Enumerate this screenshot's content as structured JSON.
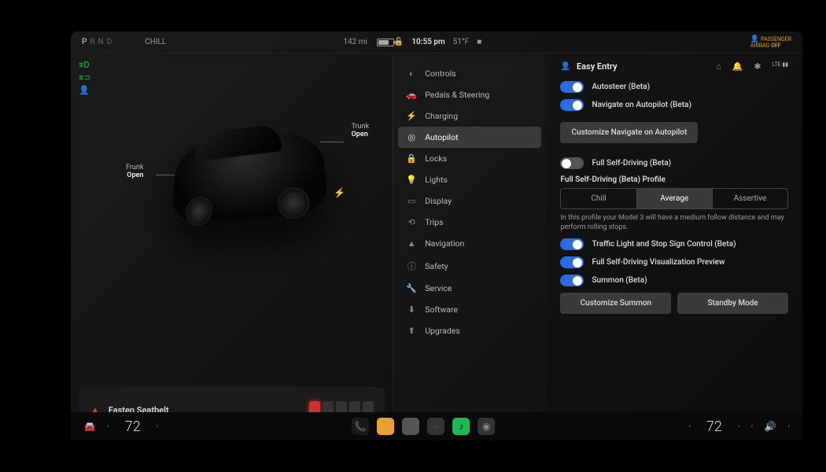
{
  "topbar": {
    "gears": [
      "P",
      "R",
      "N",
      "D"
    ],
    "active_gear": "P",
    "drive_mode": "CHILL",
    "range": "142 mi",
    "time": "10:55 pm",
    "outside_temp": "51°F",
    "airbag_line1": "PASSENGER",
    "airbag_line2": "AIRBAG",
    "airbag_off": "OFF",
    "lte": "LTE"
  },
  "car": {
    "frunk_label": "Frunk",
    "frunk_state": "Open",
    "trunk_label": "Trunk",
    "trunk_state": "Open",
    "seatbelt_warning": "Fasten Seatbelt"
  },
  "menu": {
    "items": [
      {
        "icon": "◐",
        "label": "Controls"
      },
      {
        "icon": "🚗",
        "label": "Pedals & Steering"
      },
      {
        "icon": "⚡",
        "label": "Charging"
      },
      {
        "icon": "◎",
        "label": "Autopilot"
      },
      {
        "icon": "🔒",
        "label": "Locks"
      },
      {
        "icon": "💡",
        "label": "Lights"
      },
      {
        "icon": "▭",
        "label": "Display"
      },
      {
        "icon": "⟲",
        "label": "Trips"
      },
      {
        "icon": "▲",
        "label": "Navigation"
      },
      {
        "icon": "ⓘ",
        "label": "Safety"
      },
      {
        "icon": "🔧",
        "label": "Service"
      },
      {
        "icon": "⬇",
        "label": "Software"
      },
      {
        "icon": "⬆",
        "label": "Upgrades"
      }
    ],
    "active_index": 3
  },
  "settings": {
    "profile_label": "Easy Entry",
    "autosteer": {
      "label": "Autosteer (Beta)",
      "on": true
    },
    "nav_autopilot": {
      "label": "Navigate on Autopilot (Beta)",
      "on": true
    },
    "customize_nav_btn": "Customize Navigate on Autopilot",
    "fsd": {
      "label": "Full Self-Driving (Beta)",
      "on": false
    },
    "fsd_profile_title": "Full Self-Driving (Beta) Profile",
    "fsd_profiles": [
      "Chill",
      "Average",
      "Assertive"
    ],
    "fsd_profile_active": 1,
    "fsd_desc": "In this profile your Model 3 will have a medium follow distance and may perform rolling stops.",
    "traffic_light": {
      "label": "Traffic Light and Stop Sign Control (Beta)",
      "on": true
    },
    "fsd_viz": {
      "label": "Full Self-Driving Visualization Preview",
      "on": true
    },
    "summon": {
      "label": "Summon (Beta)",
      "on": true
    },
    "customize_summon_btn": "Customize Summon",
    "standby_btn": "Standby Mode"
  },
  "dock": {
    "temp_left": "72",
    "temp_right": "72"
  }
}
